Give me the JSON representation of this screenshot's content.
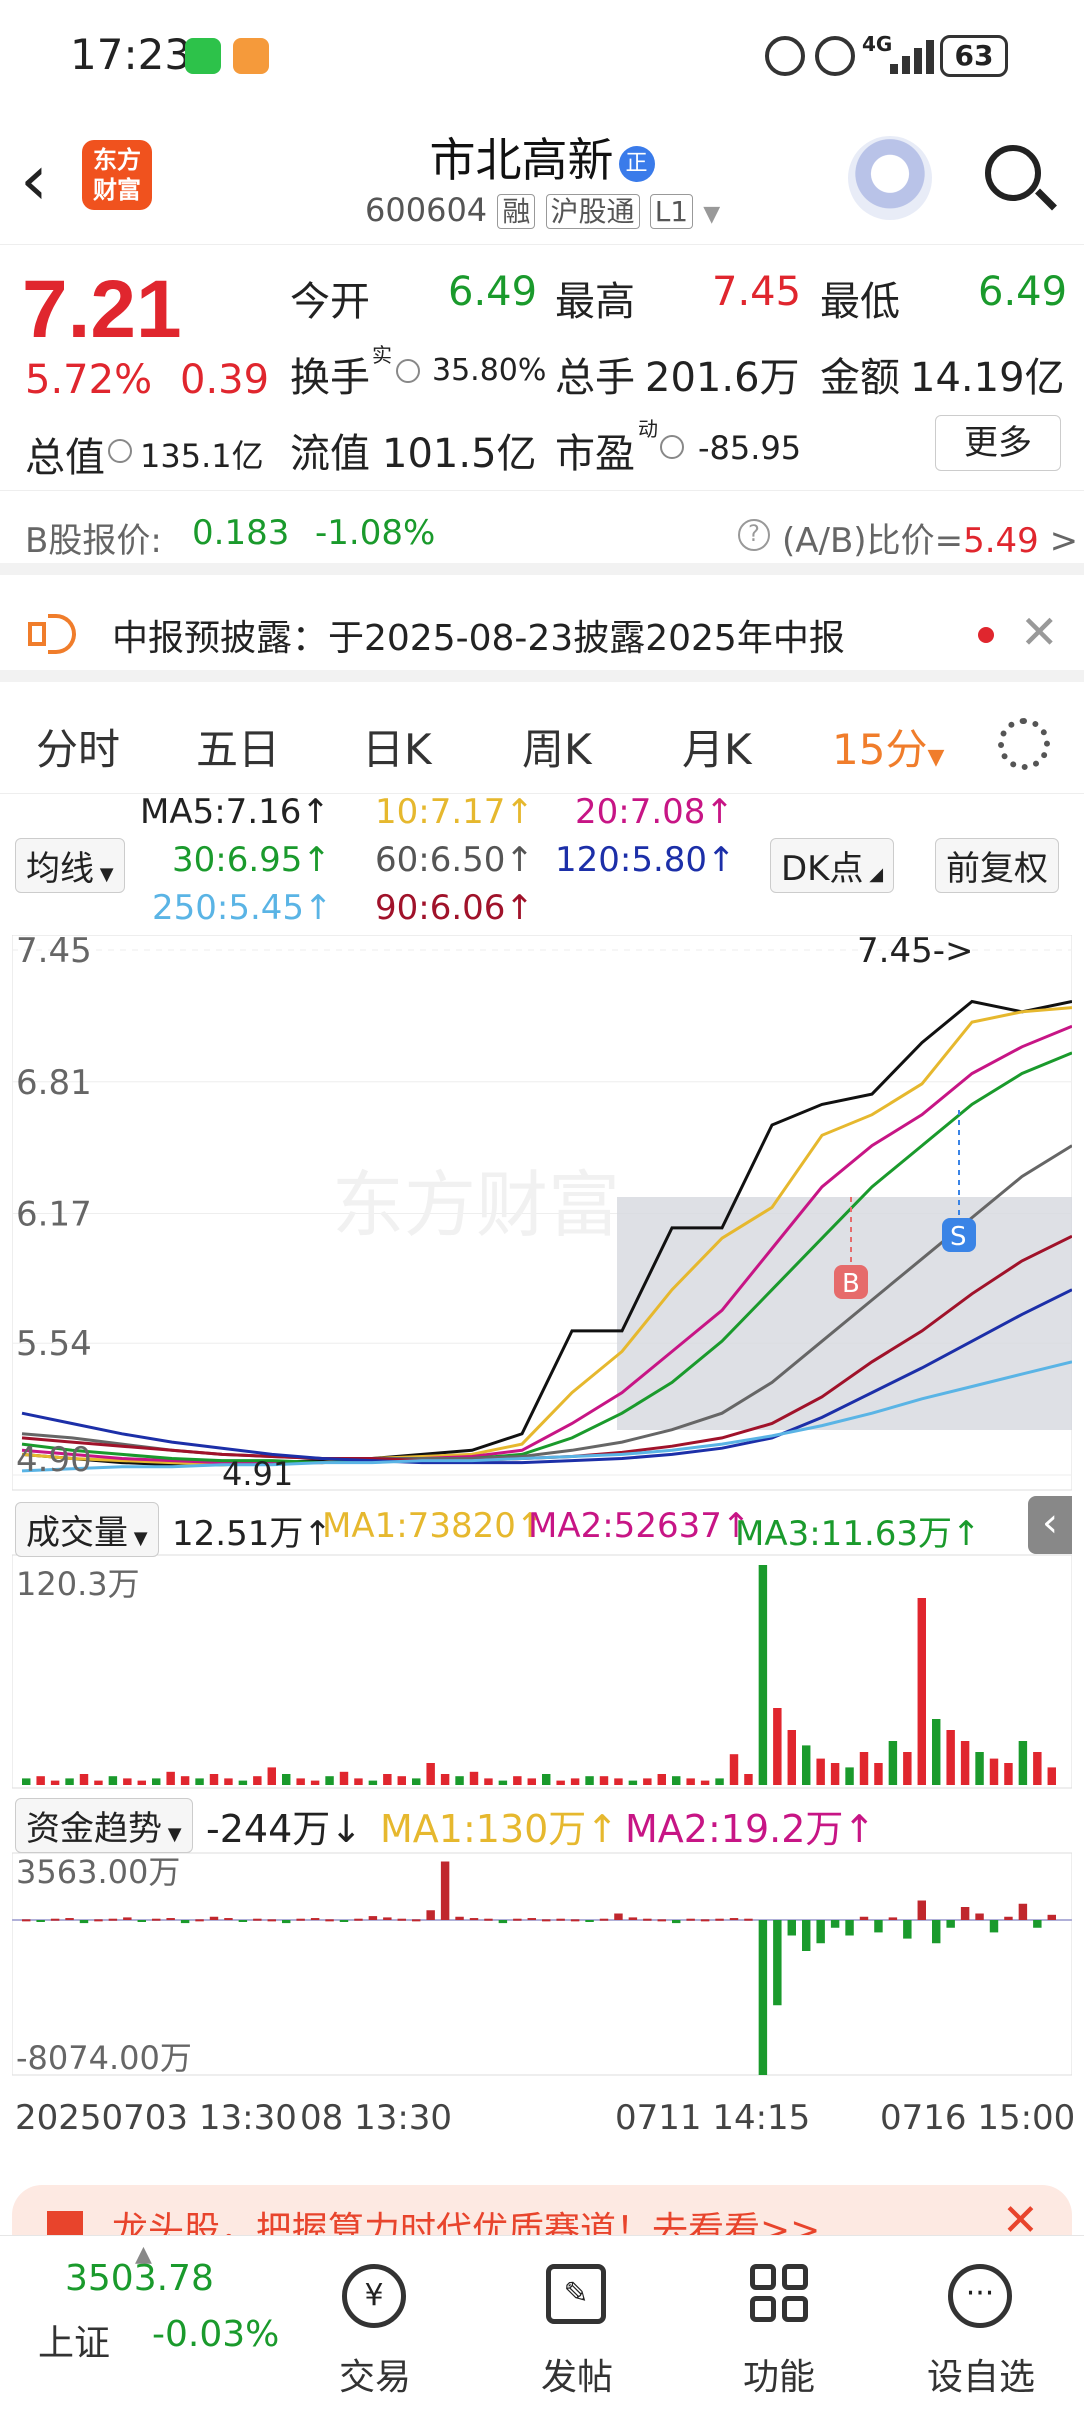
{
  "status": {
    "time": "17:23",
    "battery": "63",
    "signal": "4G"
  },
  "header": {
    "title": "市北高新",
    "badge": "正",
    "code": "600604",
    "tags": [
      "融",
      "沪股通",
      "L1"
    ],
    "logo": "东方\n财富"
  },
  "quote": {
    "price": "7.21",
    "pct": "5.72%",
    "chg": "0.39",
    "open_label": "今开",
    "open": "6.49",
    "high_label": "最高",
    "high": "7.45",
    "low_label": "最低",
    "low": "6.49",
    "turnover_label": "换手",
    "turnover_sup": "实",
    "turnover": "35.80%",
    "volume_label": "总手",
    "volume": "201.6万",
    "amount_label": "金额",
    "amount": "14.19亿",
    "mktcap_label": "总值",
    "mktcap": "135.1亿",
    "float_label": "流值",
    "float": "101.5亿",
    "pe_label": "市盈",
    "pe_sup": "动",
    "pe": "-85.95",
    "more_label": "更多"
  },
  "bshare": {
    "label": "B股报价:",
    "price": "0.183",
    "pct": "-1.08%",
    "ratio_label": "(A/B)比价=",
    "ratio": "5.49",
    "arrow": ">"
  },
  "notice": {
    "text": "中报预披露：于2025-08-23披露2025年中报"
  },
  "tabs": [
    "分时",
    "五日",
    "日K",
    "周K",
    "月K",
    "15分"
  ],
  "ma": {
    "selector": "均线",
    "ma5": "MA5:7.16↑",
    "ma10": "10:7.17↑",
    "ma20": "20:7.08↑",
    "ma30": "30:6.95↑",
    "ma60": "60:6.50↑",
    "ma120": "120:5.80↑",
    "ma250": "250:5.45↑",
    "ma90": "90:6.06↑",
    "dk_label": "DK点",
    "fq_label": "前复权"
  },
  "chart_data": {
    "type": "line",
    "price_axis": [
      "7.45",
      "6.81",
      "6.17",
      "5.54",
      "4.90"
    ],
    "high_marker": "7.45->",
    "low_marker": "4.91",
    "watermark": "东方财富",
    "buy_label": "B",
    "sell_label": "S",
    "ylim": [
      4.9,
      7.45
    ],
    "x_labels": [
      "20250703 13:30",
      "08 13:30",
      "0711 14:15",
      "0716 15:00"
    ],
    "series": [
      {
        "values": [
          5.0,
          4.98,
          4.96,
          4.95,
          4.95,
          4.96,
          4.97,
          4.98,
          5.0,
          5.02,
          5.1,
          5.6,
          5.6,
          6.1,
          6.1,
          6.6,
          6.7,
          6.75,
          7.0,
          7.2,
          7.15,
          7.2
        ]
      },
      {
        "values": [
          5.0,
          4.98,
          4.97,
          4.96,
          4.95,
          4.96,
          4.96,
          4.98,
          4.99,
          5.0,
          5.05,
          5.3,
          5.5,
          5.8,
          6.05,
          6.2,
          6.55,
          6.65,
          6.8,
          7.1,
          7.15,
          7.17
        ]
      },
      {
        "values": [
          5.02,
          5.0,
          4.98,
          4.97,
          4.96,
          4.96,
          4.96,
          4.97,
          4.98,
          4.99,
          5.02,
          5.15,
          5.3,
          5.5,
          5.7,
          6.0,
          6.3,
          6.5,
          6.65,
          6.85,
          6.98,
          7.08
        ]
      },
      {
        "values": [
          5.05,
          5.02,
          5.0,
          4.98,
          4.97,
          4.97,
          4.96,
          4.97,
          4.97,
          4.98,
          5.0,
          5.08,
          5.2,
          5.35,
          5.55,
          5.8,
          6.05,
          6.3,
          6.5,
          6.7,
          6.85,
          6.95
        ]
      },
      {
        "values": [
          5.1,
          5.08,
          5.05,
          5.02,
          5.0,
          4.99,
          4.98,
          4.98,
          4.98,
          4.98,
          4.99,
          5.02,
          5.06,
          5.12,
          5.2,
          5.35,
          5.55,
          5.75,
          5.95,
          6.15,
          6.35,
          6.5
        ]
      },
      {
        "values": [
          5.08,
          5.06,
          5.04,
          5.02,
          5.0,
          4.99,
          4.98,
          4.98,
          4.97,
          4.97,
          4.98,
          4.99,
          5.01,
          5.04,
          5.08,
          5.15,
          5.28,
          5.45,
          5.6,
          5.78,
          5.94,
          6.06
        ]
      },
      {
        "values": [
          5.2,
          5.15,
          5.1,
          5.06,
          5.03,
          5.0,
          4.98,
          4.97,
          4.96,
          4.96,
          4.96,
          4.97,
          4.98,
          5.0,
          5.03,
          5.08,
          5.18,
          5.3,
          5.42,
          5.55,
          5.68,
          5.8
        ]
      },
      {
        "values": [
          4.92,
          4.93,
          4.94,
          4.94,
          4.95,
          4.95,
          4.96,
          4.96,
          4.97,
          4.97,
          4.98,
          4.99,
          5.0,
          5.02,
          5.05,
          5.09,
          5.14,
          5.2,
          5.27,
          5.33,
          5.39,
          5.45
        ]
      }
    ]
  },
  "volume": {
    "selector": "成交量",
    "value": "12.51万↑",
    "ma1": "MA1:73820↑",
    "ma2": "MA2:52637↑",
    "ma3": "MA3:11.63万↑",
    "axis_top": "120.3万",
    "bars": [
      0.03,
      0.04,
      0.02,
      0.03,
      0.05,
      0.02,
      0.04,
      0.03,
      0.02,
      0.03,
      0.06,
      0.04,
      0.03,
      0.05,
      0.03,
      0.02,
      0.04,
      0.08,
      0.05,
      0.03,
      0.02,
      0.04,
      0.06,
      0.03,
      0.02,
      0.05,
      0.04,
      0.03,
      0.1,
      0.05,
      0.04,
      0.06,
      0.03,
      0.02,
      0.04,
      0.03,
      0.05,
      0.02,
      0.03,
      0.04,
      0.04,
      0.03,
      0.02,
      0.03,
      0.05,
      0.04,
      0.03,
      0.02,
      0.03,
      0.14,
      0.05,
      1.0,
      0.35,
      0.25,
      0.18,
      0.12,
      0.1,
      0.08,
      0.15,
      0.1,
      0.2,
      0.15,
      0.85,
      0.3,
      0.25,
      0.2,
      0.15,
      0.12,
      0.1,
      0.2,
      0.15,
      0.08
    ]
  },
  "money": {
    "selector": "资金趋势",
    "value": "-244万↓",
    "ma1": "MA1:130万↑",
    "ma2": "MA2:19.2万↑",
    "axis_top": "3563.00万",
    "axis_bottom": "-8074.00万",
    "bars": [
      0.01,
      -0.01,
      0.02,
      0.03,
      -0.02,
      0.01,
      0.02,
      0.04,
      -0.01,
      0.02,
      0.03,
      -0.02,
      0.01,
      0.05,
      0.03,
      -0.01,
      0.02,
      0.01,
      -0.02,
      0.02,
      0.03,
      0.01,
      -0.01,
      0.02,
      0.06,
      0.04,
      0.02,
      0.01,
      0.15,
      0.9,
      0.05,
      0.03,
      0.02,
      -0.02,
      0.02,
      0.03,
      0.01,
      0.02,
      0.01,
      -0.01,
      0.02,
      0.1,
      0.04,
      0.02,
      0.01,
      -0.02,
      0.02,
      0.01,
      0.02,
      0.03,
      0.02,
      -1.0,
      -0.55,
      -0.1,
      -0.2,
      -0.15,
      -0.05,
      -0.1,
      0.05,
      -0.08,
      0.04,
      -0.12,
      0.3,
      -0.15,
      -0.05,
      0.2,
      0.1,
      -0.08,
      0.05,
      0.25,
      -0.05,
      0.08
    ]
  },
  "ad": {
    "text": "龙头股，把握算力时代优质赛道！去看看>>"
  },
  "bottom": {
    "index_value": "3503.78",
    "index_name": "上证",
    "index_pct": "-0.03%",
    "nav": [
      "交易",
      "发帖",
      "功能",
      "设自选"
    ]
  }
}
